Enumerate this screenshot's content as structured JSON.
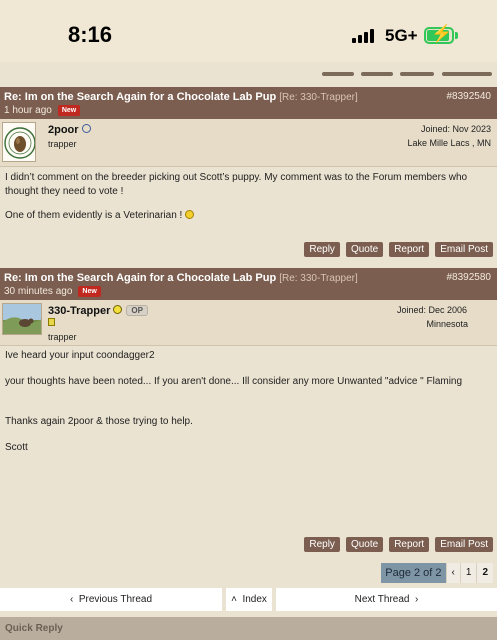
{
  "status_bar": {
    "time": "8:16",
    "network": "5G+",
    "battery_color": "#32c759"
  },
  "posts": [
    {
      "title": "Re: Im on the Search Again for a Chocolate Lab Pup",
      "reply_to": "[Re: 330-Trapper]",
      "time": "1 hour ago",
      "badge": "New",
      "post_id": "#8392540",
      "username": "2poor",
      "rank": "trapper",
      "joined": "Joined: Nov 2023",
      "location": "Lake Mille Lacs , MN",
      "body": [
        "I didn’t comment on the breeder picking out Scott’s puppy. My comment was to the Forum members who thought they need to vote !",
        "One of them evidently is a Veterinarian !"
      ]
    },
    {
      "title": "Re: Im on the Search Again for a Chocolate Lab Pup",
      "reply_to": "[Re: 330-Trapper]",
      "time": "30 minutes ago",
      "badge": "New",
      "post_id": "#8392580",
      "username": "330-Trapper",
      "op_badge": "OP",
      "rank": "trapper",
      "joined": "Joined: Dec 2006",
      "location": "Minnesota",
      "body": [
        "Ive heard your input coondagger2",
        "your thoughts have been noted... If you aren't done... Ill consider any more Unwanted \"advice \" Flaming",
        "Thanks again 2poor & those trying to help.",
        "Scott"
      ]
    }
  ],
  "actions": {
    "reply": "Reply",
    "quote": "Quote",
    "report": "Report",
    "email": "Email Post"
  },
  "pagination": {
    "label": "Page 2 of 2",
    "prev": "‹",
    "pages": [
      "1",
      "2"
    ],
    "current": "2"
  },
  "thread_nav": {
    "previous": "Previous Thread",
    "index": "Index",
    "next": "Next Thread"
  },
  "quick_reply": "Quick Reply",
  "colors": {
    "page_bg": "#ebe3d1",
    "header_brown": "#7b5e4f",
    "new_badge": "#c0291f",
    "pager_blue": "#7e95a6"
  }
}
